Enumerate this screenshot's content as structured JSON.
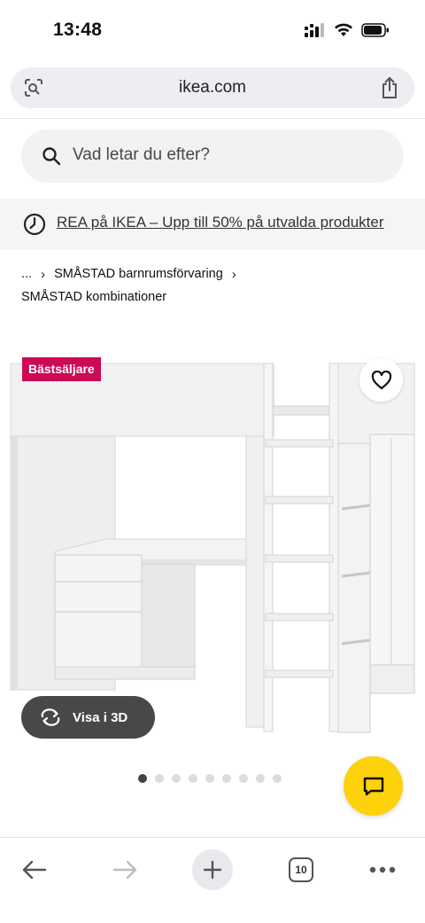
{
  "status_bar": {
    "time": "13:48"
  },
  "browser": {
    "url": "ikea.com",
    "tabs_count": "10"
  },
  "search": {
    "placeholder": "Vad letar du efter?"
  },
  "promo": {
    "text": "REA på IKEA – Upp till 50% på utvalda produkter"
  },
  "breadcrumb": {
    "ellipsis": "...",
    "separator": "›",
    "parent": "SMÅSTAD barnrumsförvaring",
    "current": "SMÅSTAD kombinationer"
  },
  "product": {
    "badge": "Bästsäljare",
    "view3d_label": "Visa i 3D",
    "image_count": 9,
    "active_image": 1
  },
  "colors": {
    "badge_bg": "#cc0a56",
    "chat_bg": "#fdd20a",
    "view3d_bg": "#484848"
  },
  "icons": [
    "lens-icon",
    "share-icon",
    "search-icon",
    "clock-icon",
    "heart-icon",
    "rotate-3d-icon",
    "chat-icon",
    "back-arrow-icon",
    "forward-arrow-icon",
    "plus-icon",
    "tabs-icon",
    "more-icon"
  ]
}
